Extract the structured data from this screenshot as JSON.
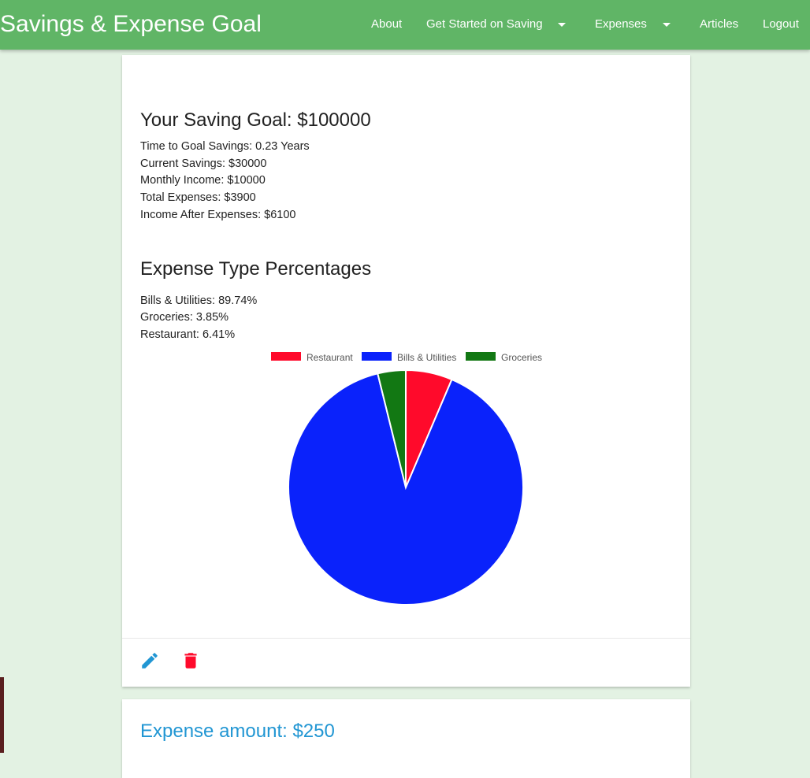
{
  "navbar": {
    "brand": "Savings & Expense Goal",
    "items": {
      "about": "About",
      "get_started": "Get Started on Saving",
      "expenses": "Expenses",
      "articles": "Articles",
      "logout": "Logout"
    }
  },
  "goal_card": {
    "title": "Your Saving Goal: $100000",
    "stats": [
      "Time to Goal Savings: 0.23 Years",
      "Current Savings: $30000",
      "Monthly Income: $10000",
      "Total Expenses: $3900",
      "Income After Expenses: $6100"
    ],
    "percentages_title": "Expense Type Percentages",
    "percentages": [
      "Bills & Utilities: 89.74%",
      "Groceries: 3.85%",
      "Restaurant: 6.41%"
    ],
    "actions": {
      "edit_icon": "pencil-icon",
      "delete_icon": "trash-icon"
    }
  },
  "chart_data": {
    "type": "pie",
    "categories": [
      "Restaurant",
      "Bills & Utilities",
      "Groceries"
    ],
    "values": [
      6.41,
      89.74,
      3.85
    ],
    "colors": [
      "#ff0a2b",
      "#0a22fb",
      "#127813"
    ],
    "legend": "top"
  },
  "expense_card": {
    "amount_label": "Expense amount: $250"
  }
}
